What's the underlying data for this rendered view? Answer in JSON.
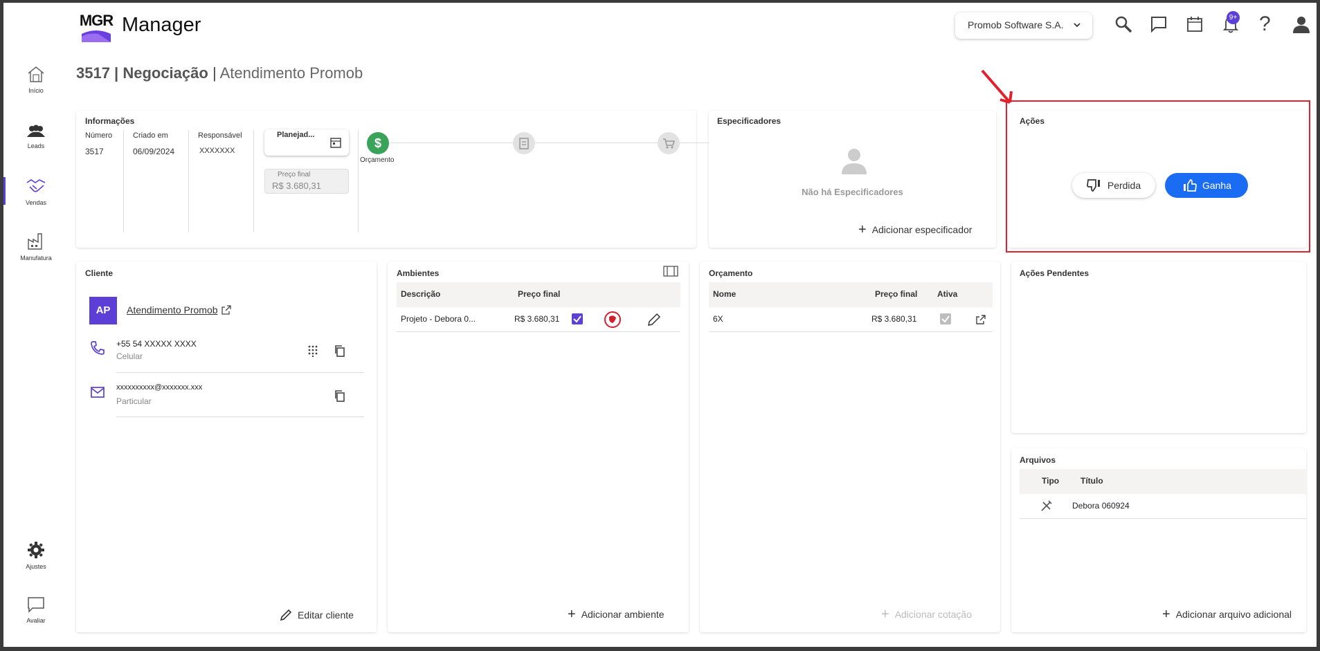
{
  "header": {
    "logo_text": "MGR",
    "app_name": "Manager",
    "company": "Promob Software S.A.",
    "notification_badge": "9+",
    "help_label": "?"
  },
  "sidebar": {
    "items": [
      {
        "label": "Início",
        "icon": "home-icon"
      },
      {
        "label": "Leads",
        "icon": "people-icon"
      },
      {
        "label": "Vendas",
        "icon": "handshake-icon"
      },
      {
        "label": "Manufatura",
        "icon": "factory-icon"
      },
      {
        "label": "Ajustes",
        "icon": "gear-icon"
      },
      {
        "label": "Avaliar",
        "icon": "chat-icon"
      }
    ]
  },
  "page": {
    "title_strong": "3517 | Negociação",
    "title_sep": " | ",
    "title_sub": "Atendimento Promob"
  },
  "informacoes": {
    "title": "Informações",
    "numero_label": "Número",
    "numero": "3517",
    "criado_label": "Criado em",
    "criado": "06/09/2024",
    "responsavel_label": "Responsável",
    "responsavel": "XXXXXXX",
    "status_select": "Planejad...",
    "preco_label": "Preço final",
    "preco": "R$ 3.680,31",
    "stage_label": "Orçamento",
    "stage_icon": "dollar-icon"
  },
  "especificadores": {
    "title": "Especificadores",
    "empty_text": "Não há Especificadores",
    "add_label": "Adicionar especificador"
  },
  "acoes": {
    "title": "Ações",
    "lost_label": "Perdida",
    "won_label": "Ganha"
  },
  "cliente": {
    "title": "Cliente",
    "avatar": "AP",
    "name": "Atendimento Promob",
    "phone": "+55 54 XXXXX XXXX",
    "phone_type": "Celular",
    "email": "xxxxxxxxxx@xxxxxxx.xxx",
    "email_type": "Particular",
    "edit_label": "Editar cliente"
  },
  "ambientes": {
    "title": "Ambientes",
    "col_desc": "Descrição",
    "col_price": "Preço final",
    "rows": [
      {
        "desc": "Projeto - Debora 0...",
        "price": "R$ 3.680,31"
      }
    ],
    "add_label": "Adicionar ambiente"
  },
  "orcamento": {
    "title": "Orçamento",
    "col_name": "Nome",
    "col_price": "Preço final",
    "col_active": "Ativa",
    "rows": [
      {
        "name": "6X",
        "price": "R$ 3.680,31"
      }
    ],
    "add_label": "Adicionar cotação"
  },
  "acoes_pendentes": {
    "title": "Ações Pendentes"
  },
  "arquivos": {
    "title": "Arquivos",
    "col_tipo": "Tipo",
    "col_titulo": "Título",
    "rows": [
      {
        "title": "Debora 060924"
      }
    ],
    "add_label": "Adicionar arquivo adicional"
  },
  "colors": {
    "accent": "#5b3fd6",
    "primary_button": "#1a6df2",
    "stage_active": "#3aa35a",
    "highlight_box": "#e4202e"
  }
}
